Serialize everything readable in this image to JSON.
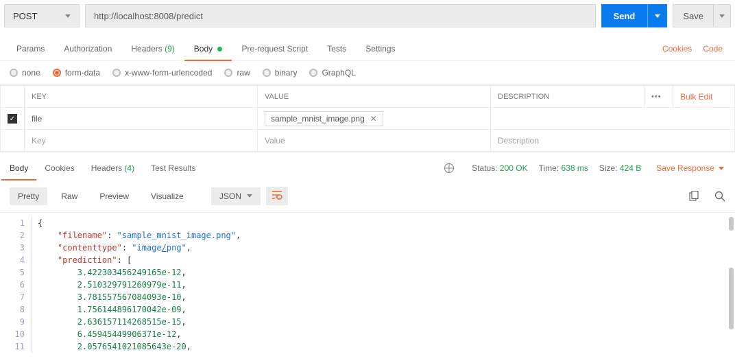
{
  "request": {
    "method": "POST",
    "url": "http://localhost:8008/predict",
    "send_label": "Send",
    "save_label": "Save"
  },
  "req_tabs": {
    "params": "Params",
    "auth": "Authorization",
    "headers": "Headers",
    "headers_count": "(9)",
    "body": "Body",
    "prerequest": "Pre-request Script",
    "tests": "Tests",
    "settings": "Settings",
    "cookies_link": "Cookies",
    "code_link": "Code"
  },
  "body_types": {
    "none": "none",
    "formdata": "form-data",
    "urlencoded": "x-www-form-urlencoded",
    "raw": "raw",
    "binary": "binary",
    "graphql": "GraphQL"
  },
  "table_headers": {
    "key": "KEY",
    "value": "VALUE",
    "desc": "DESCRIPTION",
    "bulk": "Bulk Edit"
  },
  "form_row": {
    "key": "file",
    "file_name": "sample_mnist_image.png"
  },
  "placeholders": {
    "key": "Key",
    "value": "Value",
    "desc": "Description"
  },
  "resp_tabs": {
    "body": "Body",
    "cookies": "Cookies",
    "headers": "Headers",
    "headers_count": "(4)",
    "tests": "Test Results"
  },
  "status": {
    "status_label": "Status:",
    "status_val": "200 OK",
    "time_label": "Time:",
    "time_val": "638 ms",
    "size_label": "Size:",
    "size_val": "424 B",
    "save_response": "Save Response"
  },
  "viewer": {
    "pretty": "Pretty",
    "raw": "Raw",
    "preview": "Preview",
    "visualize": "Visualize",
    "format": "JSON"
  },
  "json": {
    "k_filename": "\"filename\"",
    "v_filename": "\"sample_mnist_image.png\"",
    "k_contenttype": "\"contenttype\"",
    "v_contenttype_a": "\"image",
    "v_contenttype_b": "png\"",
    "k_prediction": "\"prediction\"",
    "pred": [
      "3.422303456249165e-12",
      "2.510329791260979e-11",
      "3.781557567084093e-10",
      "1.756144896170042e-09",
      "2.636157114268515e-15",
      "6.45945449906371e-12",
      "2.0576541021085643e-20"
    ]
  }
}
